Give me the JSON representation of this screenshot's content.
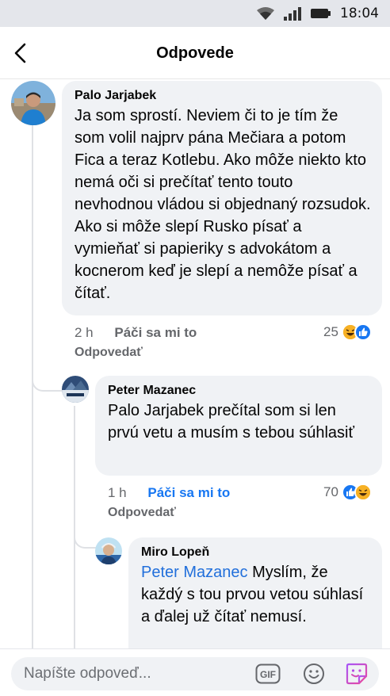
{
  "status_bar": {
    "time": "18:04"
  },
  "header": {
    "title": "Odpovede"
  },
  "comments": [
    {
      "author": "Palo Jarjabek",
      "text": "Ja som sprostí. Neviem či to je tím že som volil najprv pána Mečiara a potom Fica a teraz Kotlebu. Ako môže niekto kto nemá oči si prečítať tento touto nevhodnou vládou si objednaný rozsudok. Ako si môže slepí Rusko písať a vymieňať si papieriky s advokátom a kocnerom keď je slepí a nemôže písať a čítať.",
      "time": "2 h",
      "like_label": "Páči sa mi to",
      "reply_label": "Odpovedať",
      "reaction_count": "25",
      "reactions": [
        "haha-icon",
        "like-icon"
      ]
    },
    {
      "author": "Peter Mazanec",
      "text": "Palo Jarjabek prečítal som si len prvú vetu a musím s tebou súhlasiť",
      "time": "1 h",
      "like_label": "Páči sa mi to",
      "liked": true,
      "reply_label": "Odpovedať",
      "reaction_count": "70",
      "reactions": [
        "like-icon",
        "haha-icon"
      ]
    },
    {
      "author": "Miro Lopeň",
      "mention": "Peter Mazanec",
      "text": " Myslím, že každý s tou prvou vetou súhlasí a ďalej už čítať nemusí."
    }
  ],
  "composer": {
    "placeholder": "Napíšte odpoveď...",
    "gif_label": "GIF",
    "icons": [
      "gif-icon",
      "emoji-icon",
      "sticker-icon"
    ]
  },
  "colors": {
    "accent": "#1877f2",
    "bubble": "#f0f2f5",
    "mention": "#216fdb",
    "haha": "#f7b125"
  }
}
